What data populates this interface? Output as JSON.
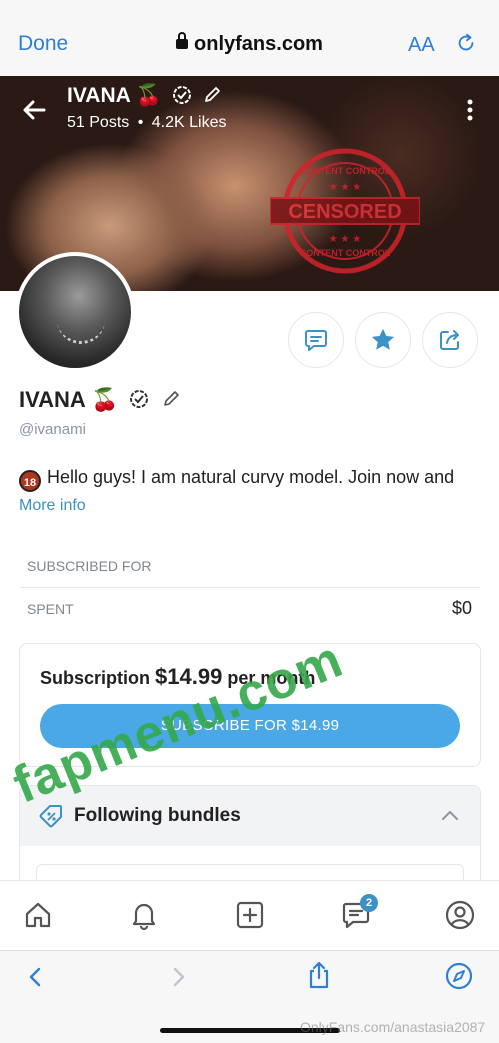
{
  "browser": {
    "done_label": "Done",
    "url": "onlyfans.com",
    "text_size_label": "AA"
  },
  "banner": {
    "name": "IVANA 🍒",
    "posts": "51 Posts",
    "separator": "•",
    "likes": "4.2K Likes",
    "stamp_text": "CENSORED",
    "stamp_ring_text": "CONTENT CONTROL"
  },
  "profile": {
    "name": "IVANA 🍒",
    "handle": "@ivanami",
    "age_badge": "18",
    "bio": "Hello guys! I am natural curvy model. Join now and",
    "more_info": "More info"
  },
  "stats": {
    "subscribed_for_label": "SUBSCRIBED FOR",
    "spent_label": "SPENT",
    "spent_value": "$0"
  },
  "subscription": {
    "prefix": "Subscription",
    "price": "$14.99",
    "suffix": "per month",
    "button_label": "SUBSCRIBE FOR $14.99"
  },
  "bundles": {
    "title": "Following bundles"
  },
  "nav": {
    "messages_badge": "2"
  },
  "watermarks": {
    "site": "fapmenu.com",
    "source": "OnlyFans.com/anastasia2087"
  },
  "colors": {
    "accent": "#4aa8e6",
    "link": "#3a92c6",
    "safari_blue": "#2f7fd8",
    "stamp_red": "#d2232a",
    "watermark_green": "#35a84a"
  }
}
